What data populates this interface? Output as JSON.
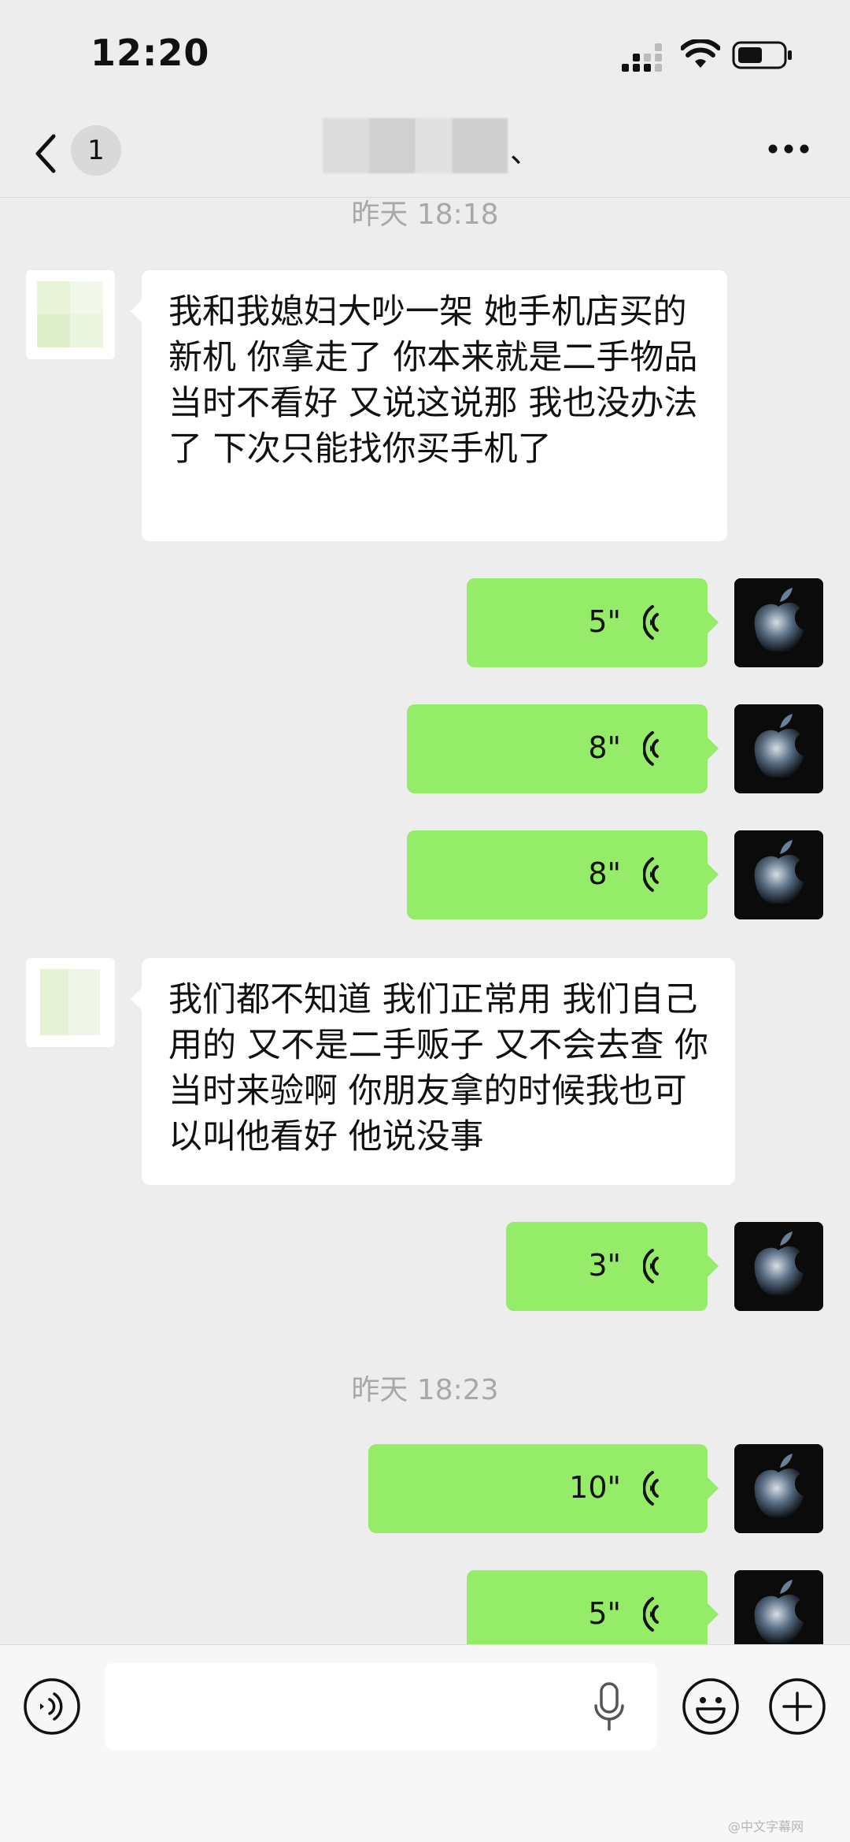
{
  "status_bar": {
    "time": "12:20"
  },
  "nav": {
    "back_badge": "1",
    "title_suffix": "、"
  },
  "messages": [
    {
      "type": "time",
      "text": "昨天 18:18"
    },
    {
      "type": "text",
      "side": "left",
      "text": "我和我媳妇大吵一架 她手机店买的新机 你拿走了 你本来就是二手物品 当时不看好 又说这说那 我也没办法了 下次只能找你买手机了"
    },
    {
      "type": "voice",
      "side": "right",
      "duration": "5\""
    },
    {
      "type": "voice",
      "side": "right",
      "duration": "8\""
    },
    {
      "type": "voice",
      "side": "right",
      "duration": "8\""
    },
    {
      "type": "text",
      "side": "left",
      "text": "我们都不知道 我们正常用 我们自己用的 又不是二手贩子 又不会去查 你当时来验啊 你朋友拿的时候我也可以叫他看好 他说没事"
    },
    {
      "type": "voice",
      "side": "right",
      "duration": "3\""
    },
    {
      "type": "time",
      "text": "昨天 18:23"
    },
    {
      "type": "voice",
      "side": "right",
      "duration": "10\""
    },
    {
      "type": "voice",
      "side": "right",
      "duration": "5\""
    }
  ],
  "input": {
    "placeholder": ""
  },
  "icons": {
    "back": "chevron-left-icon",
    "more": "more-horizontal-icon",
    "voice_toggle": "voice-mode-icon",
    "mic": "microphone-icon",
    "emoji": "emoji-icon",
    "plus": "plus-icon",
    "voice_wave": "voice-wave-icon"
  },
  "colors": {
    "bg": "#ededed",
    "bubble_self": "#95ec69",
    "bubble_other": "#ffffff"
  },
  "watermark": "@中文字幕网"
}
